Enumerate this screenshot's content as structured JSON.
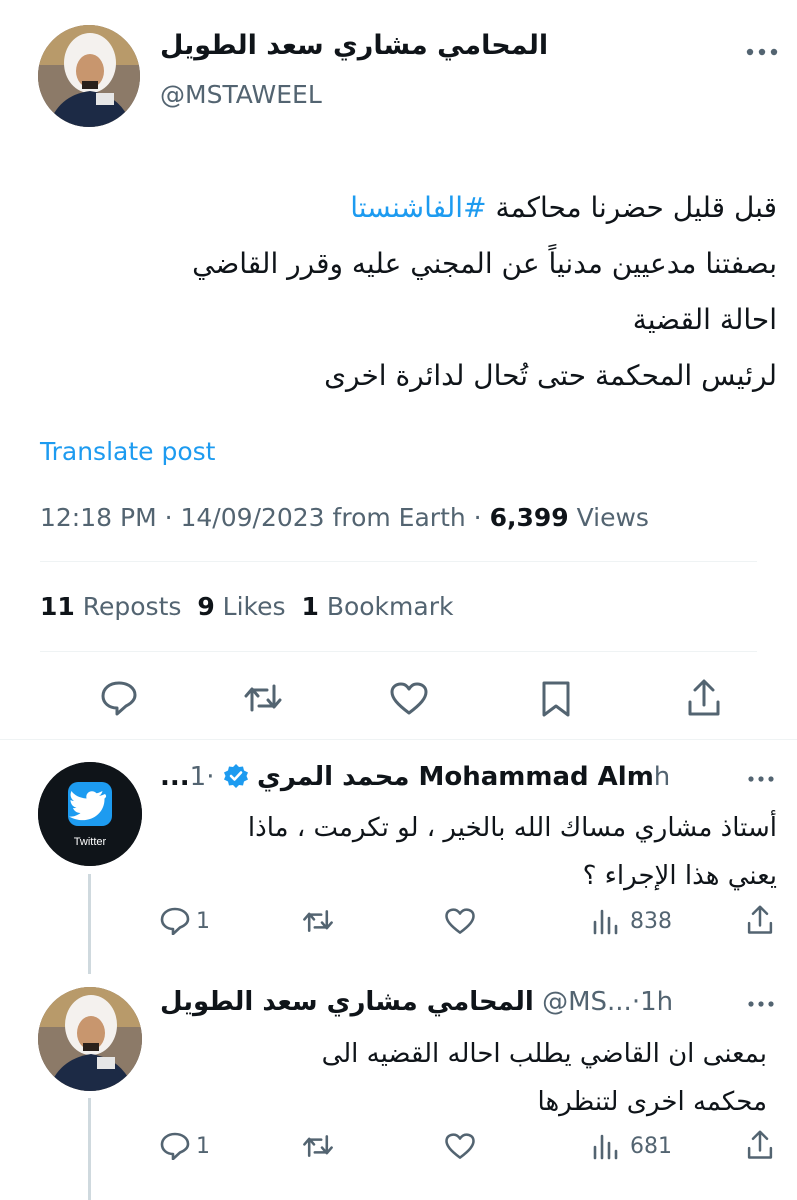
{
  "main": {
    "author_name": "المحامي مشاري سعد الطويل",
    "handle": "@MSTAWEEL",
    "body_line1_prefix": "قبل قليل حضرنا محاكمة ",
    "body_hashtag": "#الفاشنستا",
    "body_line2": "بصفتنا مدعيين مدنياً عن المجني عليه وقرر القاضي",
    "body_line3": "احالة القضية",
    "body_line4": "لرئيس المحكمة حتى تُحال لدائرة اخرى",
    "translate": "Translate post",
    "meta": {
      "time": "12:18 PM",
      "sep1": "·",
      "date": "14/09/2023",
      "from": "from Earth",
      "sep2": "·",
      "views_count": "6,399",
      "views_label": "Views"
    },
    "stats": {
      "reposts_count": "11",
      "reposts_label": "Reposts",
      "likes_count": "9",
      "likes_label": "Likes",
      "bookmarks_count": "1",
      "bookmarks_label": "Bookmark"
    }
  },
  "replies": [
    {
      "name": "Mohammad Alm محمد المري",
      "ellipsis": "...",
      "sep": "·",
      "time": "1h",
      "verified": true,
      "avatar_label": "Twitter",
      "text_line1": "أستاذ مشاري مساك الله بالخير ، لو تكرمت ، ماذا",
      "text_line2": "يعني هذا الإجراء ؟",
      "reply_count": "1",
      "views": "838"
    },
    {
      "name": "المحامي مشاري سعد الطويل",
      "handle": "@MS...",
      "sep": "·",
      "time": "1h",
      "text_line1": "بمعنى ان القاضي يطلب احاله القضيه الى",
      "text_line2": "محكمه اخرى لتنظرها",
      "reply_count": "1",
      "views": "681"
    }
  ],
  "colors": {
    "accent": "#1d9bf0",
    "muted": "#536471",
    "text": "#0f1419",
    "divider": "#eff3f4"
  },
  "icons": [
    "more-icon",
    "reply-icon",
    "repost-icon",
    "like-icon",
    "bookmark-icon",
    "share-icon",
    "views-icon",
    "verified-icon",
    "twitter-bird-icon"
  ]
}
